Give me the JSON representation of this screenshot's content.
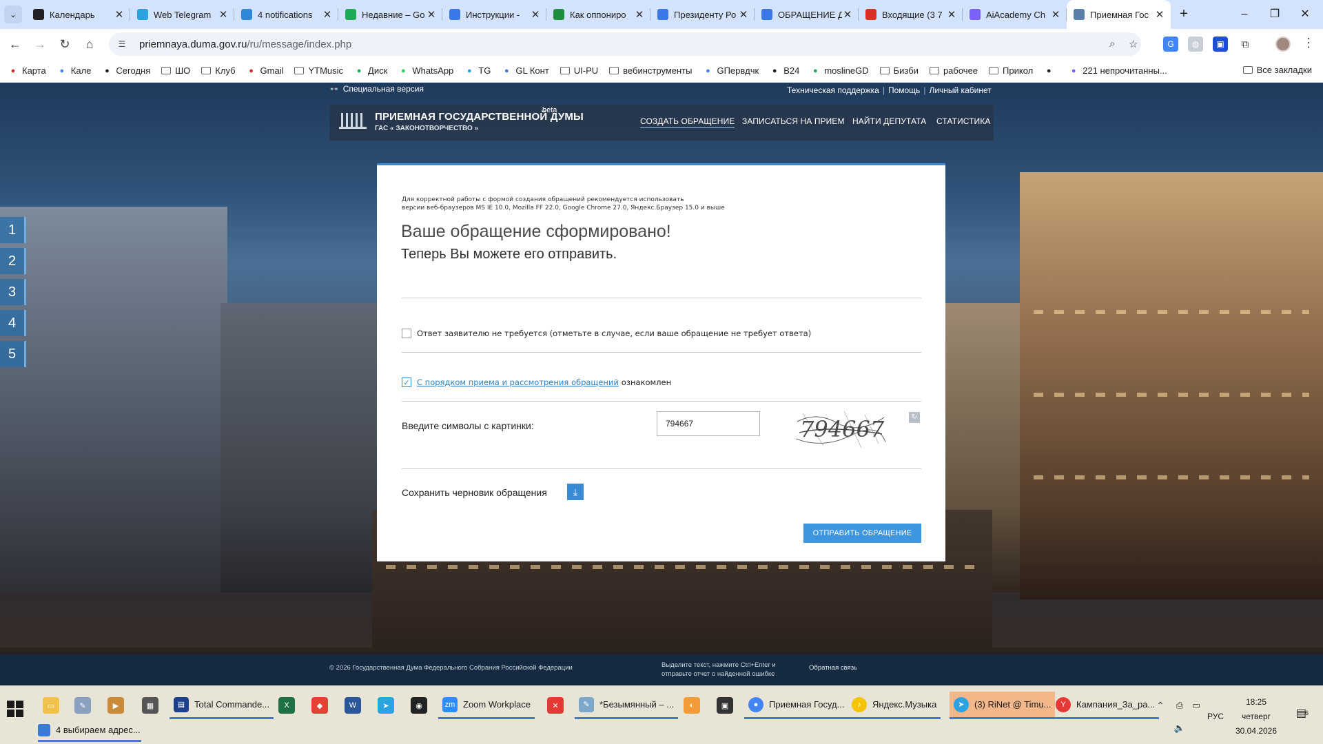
{
  "browser": {
    "tabs": [
      {
        "title": "Календарь",
        "icon_color": "#202124"
      },
      {
        "title": "Web Telegram",
        "icon_color": "#2aa3e0"
      },
      {
        "title": "4 notifications",
        "icon_color": "#2f88d9"
      },
      {
        "title": "Недавние – Go",
        "icon_color": "#1faa55"
      },
      {
        "title": "Инструкции -",
        "icon_color": "#3b78e7"
      },
      {
        "title": "Как оппониро",
        "icon_color": "#1e8e3e"
      },
      {
        "title": "Президенту Ро",
        "icon_color": "#3b78e7"
      },
      {
        "title": "ОБРАЩЕНИЕ Д",
        "icon_color": "#3b78e7"
      },
      {
        "title": "Входящие (3 7",
        "icon_color": "#d93025"
      },
      {
        "title": "AiAcademy Ch",
        "icon_color": "#7b61ff"
      },
      {
        "title": "Приемная Гос",
        "icon_color": "#5a7fa8",
        "active": true
      }
    ],
    "new_tab": "+",
    "url_host": "priemnaya.duma.gov.ru",
    "url_path": "/ru/message/index.php",
    "bookmarks": [
      {
        "label": "Карта",
        "icon": "pin-icon",
        "color": "#d93025"
      },
      {
        "label": "Кале",
        "icon": "calendar-icon",
        "color": "#4285f4"
      },
      {
        "label": "Сегодня",
        "icon": "check-circle-icon",
        "color": "#202124"
      },
      {
        "label": "ШО",
        "icon": "folder-icon"
      },
      {
        "label": "Клуб",
        "icon": "folder-icon"
      },
      {
        "label": "Gmail",
        "icon": "gmail-icon",
        "color": "#d93025"
      },
      {
        "label": "YTMusic",
        "icon": "folder-icon"
      },
      {
        "label": "Диск",
        "icon": "drive-icon",
        "color": "#1faa55"
      },
      {
        "label": "WhatsApp",
        "icon": "whatsapp-icon",
        "color": "#25d366"
      },
      {
        "label": "TG",
        "icon": "telegram-icon",
        "color": "#2aa3e0"
      },
      {
        "label": "GL Конт",
        "icon": "person-icon",
        "color": "#3b78e7"
      },
      {
        "label": "UI-PU",
        "icon": "folder-icon"
      },
      {
        "label": "вебинструменты",
        "icon": "folder-icon"
      },
      {
        "label": "GПервдчк",
        "icon": "translate-icon",
        "color": "#4285f4"
      },
      {
        "label": "B24",
        "icon": "b24-icon",
        "color": "#202124"
      },
      {
        "label": "moslineGD",
        "icon": "drive-icon",
        "color": "#1faa55"
      },
      {
        "label": "Бизби",
        "icon": "folder-icon"
      },
      {
        "label": "рабочее",
        "icon": "folder-icon"
      },
      {
        "label": "Прикол",
        "icon": "folder-icon"
      },
      {
        "label": "",
        "icon": "eye-icon",
        "color": "#202124"
      },
      {
        "label": "221 непрочитанны...",
        "icon": "mail-icon",
        "color": "#7b61ff"
      }
    ],
    "all_bookmarks": "Все закладки"
  },
  "site": {
    "special_version": "Специальная версия",
    "top_links": [
      "Техническая поддержка",
      "Помощь",
      "Личный кабинет"
    ],
    "logo_title": "ПРИЕМНАЯ ГОСУДАРСТВЕННОЙ ДУМЫ",
    "logo_subtitle": "ГАС « ЗАКОНОТВОРЧЕСТВО »",
    "beta": "beta",
    "nav": [
      "СОЗДАТЬ ОБРАЩЕНИЕ",
      "ЗАПИСАТЬСЯ НА ПРИЕМ",
      "НАЙТИ ДЕПУТАТА",
      "СТАТИСТИКА"
    ],
    "steps": [
      "1",
      "2",
      "3",
      "4",
      "5"
    ]
  },
  "form": {
    "browser_note_1": "Для корректной работы с формой создания обращений рекомендуется использовать",
    "browser_note_2": "версии веб-браузеров MS IE 10.0, Mozilla FF 22.0, Google Chrome 27.0, Яндекс.Браузер 15.0 и выше",
    "heading": "Ваше обращение сформировано!",
    "subheading": "Теперь Вы можете его отправить.",
    "no_reply_label": "Ответ заявителю не требуется (отметьте в случае, если ваше обращение не требует ответа)",
    "no_reply_checked": false,
    "rules_link": "С порядком приема и рассмотрения обращений",
    "rules_suffix": "ознакомлен",
    "rules_checked": true,
    "captcha_label": "Введите символы с картинки:",
    "captcha_value": "794667",
    "captcha_image_text": "794667",
    "draft_label": "Сохранить черновик обращения",
    "send_button": "ОТПРАВИТЬ ОБРАЩЕНИЕ"
  },
  "footer": {
    "copyright": "© 2026 Государственная Дума Федерального Собрания Российской Федерации",
    "error_note_1": "Выделите текст, нажмите Ctrl+Enter и",
    "error_note_2": "отправьте отчет о найденной ошибке",
    "feedback": "Обратная связь"
  },
  "taskbar": {
    "apps": [
      {
        "label": "Total Commande...",
        "color": "#1d3f8c"
      },
      {
        "label": "Zoom Workplace",
        "color": "#2d8cff"
      },
      {
        "label": "*Безымянный – ...",
        "color": "#7fa7c9"
      },
      {
        "label": "Приемная Госуд...",
        "color": "#4285f4"
      },
      {
        "label": "Яндекс.Музыка",
        "color": "#f5c400"
      },
      {
        "label": "(3) RiNet @ Timu...",
        "color": "#2aa3e0"
      },
      {
        "label": "Кампания_За_ра...",
        "color": "#e53935"
      }
    ],
    "second_row": "4 выбираем адрес...",
    "language": "РУС",
    "time": "18:25",
    "weekday": "четверг",
    "date": "30.04.2026",
    "notifications": "6"
  }
}
